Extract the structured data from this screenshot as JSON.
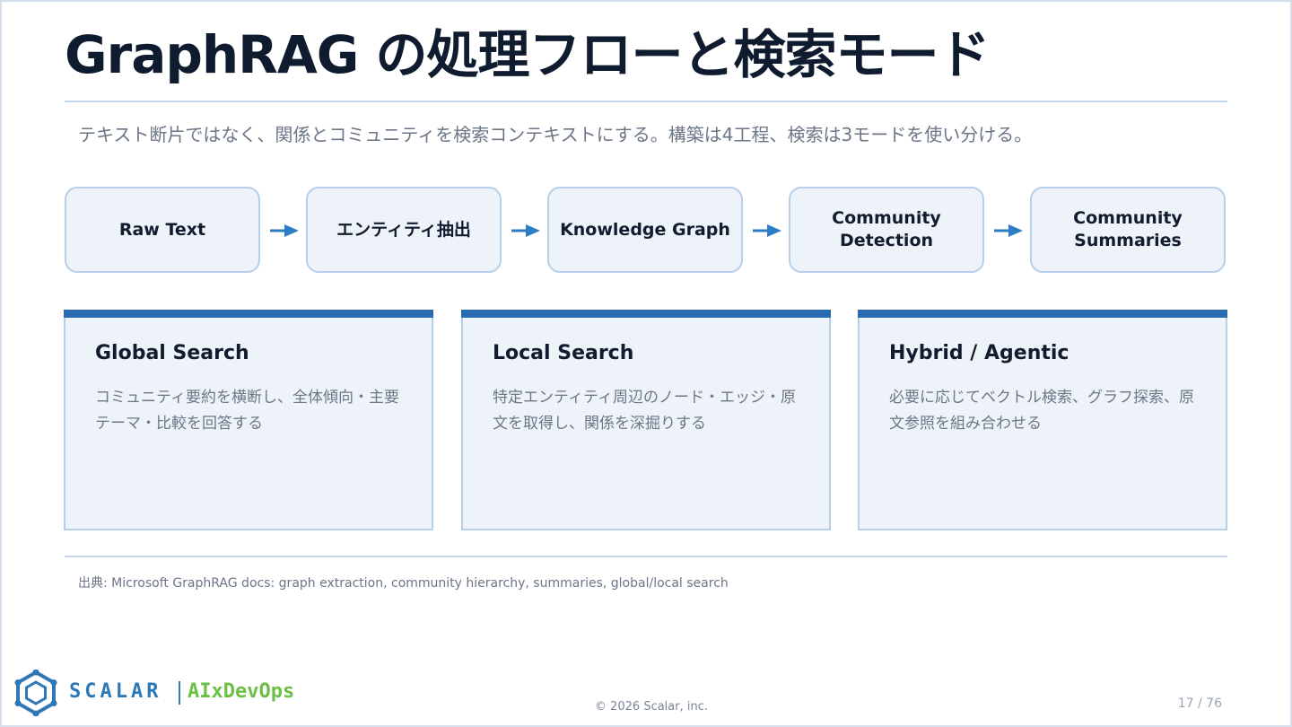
{
  "slide": {
    "title": "GraphRAG の処理フローと検索モード",
    "subtitle": "テキスト断片ではなく、関係とコミュニティを検索コンテキストにする。構築は4工程、検索は3モードを使い分ける。"
  },
  "flow": {
    "steps": [
      {
        "label": "Raw Text"
      },
      {
        "label": "エンティティ抽出"
      },
      {
        "label": "Knowledge Graph"
      },
      {
        "label": "Community Detection"
      },
      {
        "label": "Community Summaries"
      }
    ],
    "arrow_icon": "arrow-right-icon"
  },
  "modes": [
    {
      "title": "Global Search",
      "description": "コミュニティ要約を横断し、全体傾向・主要テーマ・比較を回答する"
    },
    {
      "title": "Local Search",
      "description": "特定エンティティ周辺のノード・エッジ・原文を取得し、関係を深掘りする"
    },
    {
      "title": "Hybrid / Agentic",
      "description": "必要に応じてベクトル検索、グラフ探索、原文参照を組み合わせる"
    }
  ],
  "source": "出典: Microsoft GraphRAG docs: graph extraction, community hierarchy, summaries, global/local search",
  "footer": {
    "brand": "SCALAR",
    "tagline": "AIxDevOps",
    "logo_icon": "scalar-logo-icon",
    "copyright": "© 2026 Scalar, inc.",
    "page": "17 / 76"
  },
  "colors": {
    "title": "#0f1b2e",
    "accent_bar": "#2a6ab3",
    "arrow": "#2e7dc4",
    "box_fill": "#eef3fa",
    "box_border": "#b6d0ea",
    "brand_blue": "#2e78b5",
    "brand_green": "#6cbf45"
  }
}
